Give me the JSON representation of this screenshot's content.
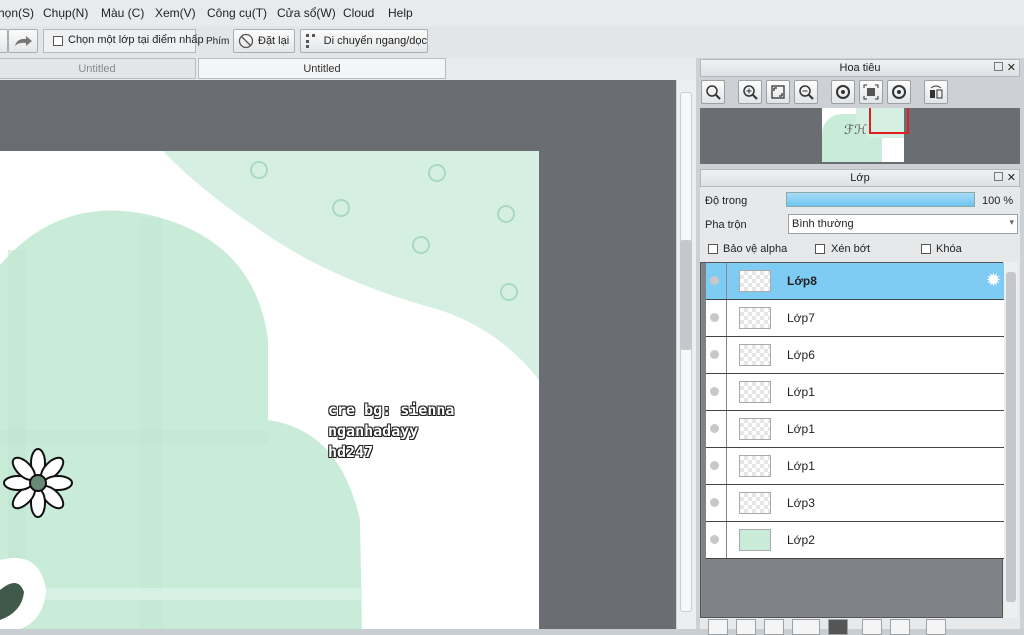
{
  "menu": [
    "họn(S)",
    "Chụp(N)",
    "Màu (C)",
    "Xem(V)",
    "Công cụ(T)",
    "Cửa sổ(W)",
    "Cloud",
    "Help"
  ],
  "toolbar": {
    "checkbox_label": "Chọn một lớp tại điểm nhấp",
    "phim_label": "Phím",
    "reset_label": "Đặt lại",
    "move_label": "Di chuyển ngang/dọc"
  },
  "tabs": [
    "Untitled",
    "Untitled"
  ],
  "canvas": {
    "credit_lines": [
      "cre bg: sienna",
      "nganhadayy",
      "hd247"
    ]
  },
  "navigator": {
    "title": "Hoa tiêu"
  },
  "layers_panel": {
    "title": "Lớp",
    "opacity_label": "Độ trong",
    "opacity_value": "100 %",
    "opacity_fraction": 1.0,
    "blend_label": "Pha trộn",
    "blend_value": "Bình thường",
    "protect_alpha": "Bảo vệ alpha",
    "clipping": "Xén bớt",
    "lock": "Khóa",
    "layers": [
      {
        "name": "Lớp8",
        "selected": true
      },
      {
        "name": "Lớp7",
        "selected": false
      },
      {
        "name": "Lớp6",
        "selected": false
      },
      {
        "name": "Lớp1",
        "selected": false
      },
      {
        "name": "Lớp1",
        "selected": false
      },
      {
        "name": "Lớp1",
        "selected": false
      },
      {
        "name": "Lớp3",
        "selected": false
      },
      {
        "name": "Lớp2",
        "selected": false
      }
    ]
  },
  "colors": {
    "accent": "#7ecbf3",
    "mint": "#c8ecd9",
    "mint_light": "#d7f1e3"
  }
}
